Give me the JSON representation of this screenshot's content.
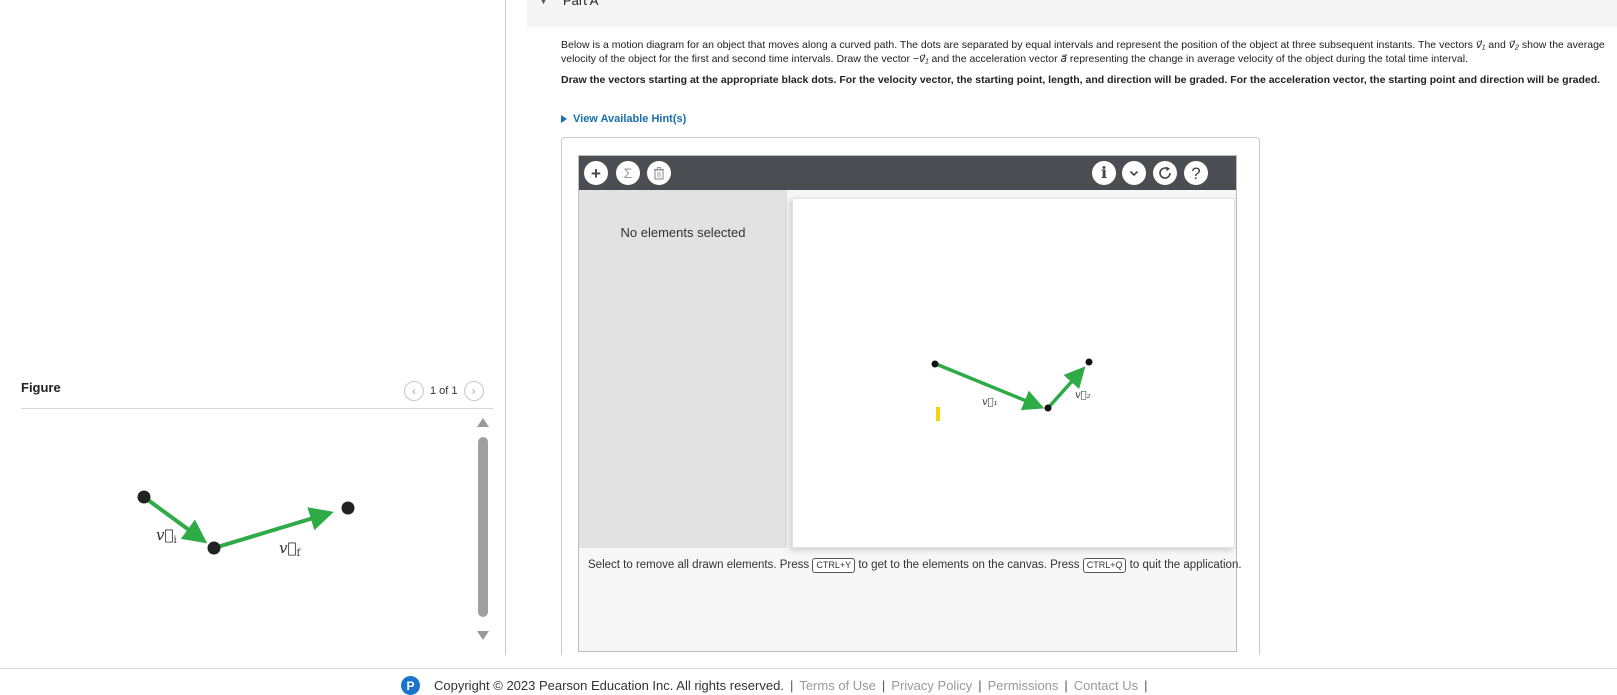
{
  "part": {
    "label": "Part A"
  },
  "question": {
    "p1_a": "Below is a motion diagram for an object that moves along a curved path. The dots are separated by equal intervals and represent the position of the object at three subsequent instants. The vectors ",
    "v1_sym": "v⃗₁",
    "p1_and": " and ",
    "v2_sym": "v⃗₂",
    "p1_b": " show the average velocity of the object for the first and second time intervals. Draw the vector ",
    "neg_v1_sym": "−v⃗₁",
    "p1_c": " and the acceleration vector ",
    "a_sym": "a⃗",
    "p1_d": " representing the change in average velocity of the object during the total time interval.",
    "p2": "Draw the vectors starting at the appropriate black dots. For the velocity vector, the starting point, length, and direction will be graded. For the acceleration vector, the starting point and direction will be graded."
  },
  "hints": {
    "label": "View Available Hint(s)"
  },
  "figure": {
    "title": "Figure",
    "counter": "1 of 1",
    "vi_label": "v⃗",
    "vi_sub": "i",
    "vf_label": "v⃗",
    "vf_sub": "f",
    "arrow_color": "#2eaa47",
    "dot_color": "#222222"
  },
  "toolbar": {
    "add_icon": "+",
    "sigma_icon": "Σ",
    "trash_icon": "trash-icon",
    "info_icon": "i",
    "help_icon": "?"
  },
  "side_panel": {
    "status": "No elements selected"
  },
  "canvas": {
    "v1_label": "v⃗₁",
    "v2_label": "v⃗₂",
    "cursor_color": "#f5d20a"
  },
  "instruction": {
    "part1": "Select to remove all drawn elements. Press ",
    "key1": "CTRL+Y",
    "part2": " to get to the elements on the canvas. Press ",
    "key2": "CTRL+Q",
    "part3": " to quit the application."
  },
  "footer": {
    "logo": "P",
    "copyright": "Copyright © 2023  Pearson Education Inc. All rights reserved.",
    "links": [
      "Terms of Use",
      "Privacy Policy",
      "Permissions",
      "Contact Us"
    ]
  }
}
